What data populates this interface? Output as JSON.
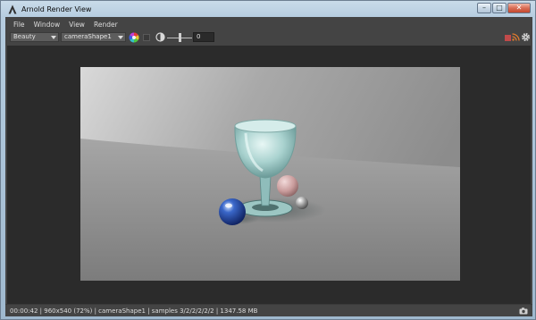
{
  "window": {
    "title": "Arnold Render View",
    "minimize_glyph": "–",
    "maximize_glyph": "□",
    "close_glyph": "✕"
  },
  "menubar": {
    "items": [
      "File",
      "Window",
      "View",
      "Render"
    ]
  },
  "toolbar": {
    "aov_value": "Beauty",
    "camera_value": "cameraShape1",
    "exposure_value": "0",
    "icons": [
      "color-wheel-icon",
      "background-toggle-icon",
      "exposure-icon",
      "stop-render-icon",
      "feed-icon",
      "gear-icon"
    ]
  },
  "viewport": {
    "content": "render-image"
  },
  "statusbar": {
    "text": "00:00:42 | 960x540 (72%) | cameraShape1  | samples 3/2/2/2/2/2 | 1347.58 MB",
    "icon": "camera-icon"
  },
  "colors": {
    "panel": "#444444",
    "viewport_bg": "#2b2b2b",
    "stop_red": "#c14a4a"
  }
}
